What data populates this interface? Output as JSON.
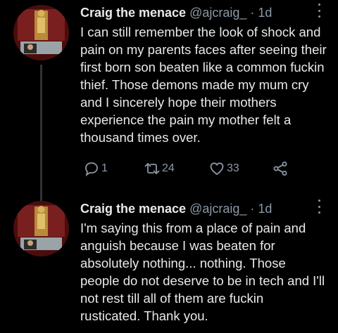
{
  "tweets": [
    {
      "name": "Craig the menace",
      "handle": "@ajcraig_",
      "separator": "·",
      "time": "1d",
      "text": "I can still remember the look of shock and pain on my parents faces after seeing their first born son beaten like a common fuckin thief. Those demons made my mum cry and I sincerely hope their mothers experience the pain my mother felt a thousand times over.",
      "actions": {
        "replies": "1",
        "retweets": "24",
        "likes": "33"
      },
      "icons": [
        "reply-icon",
        "retweet-icon",
        "like-icon",
        "share-icon"
      ]
    },
    {
      "name": "Craig the menace",
      "handle": "@ajcraig_",
      "separator": "·",
      "time": "1d",
      "text": "I'm saying this from a place of pain and anguish because I was beaten for absolutely nothing... nothing. Those people do not deserve to be in tech and I'll not rest till all of them are fuckin rusticated. Thank you."
    }
  ],
  "colors": {
    "background": "#000000",
    "text": "#e7e9ea",
    "muted": "#8b98a5",
    "thread_line": "#2f3336"
  }
}
